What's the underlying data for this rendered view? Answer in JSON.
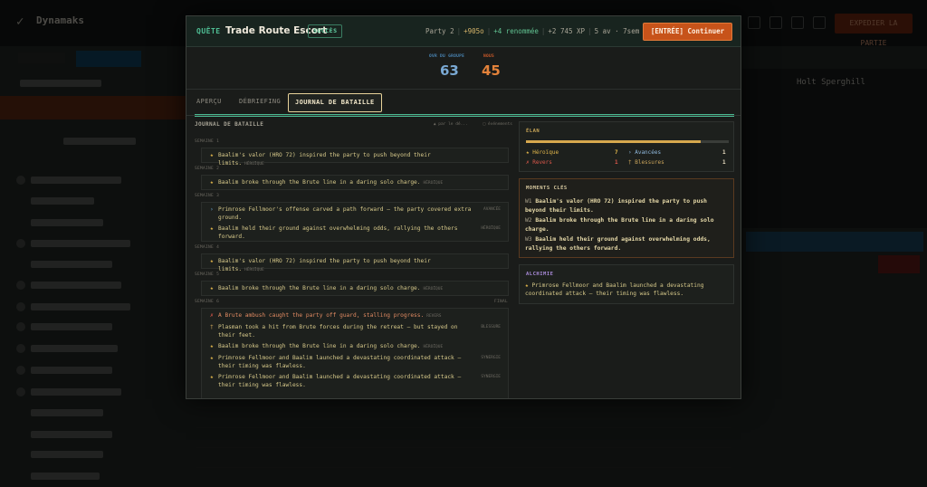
{
  "background": {
    "brand": "Dynamaks",
    "alert_label": "EXPEDIER LA PARTIE",
    "profile_name": "Holt Sperghill"
  },
  "quest": {
    "label": "QUÊTE",
    "title": "Trade Route Escort",
    "status": "SUCCÈS",
    "party": "Party 2",
    "gold": "+905o",
    "renown": "+4 renommée",
    "xp": "+2 745 XP",
    "time": "5 av · 7sem",
    "continue_label": "[ENTRÉE] Continuer"
  },
  "scores": {
    "group_label": "OVR DU GROUPE",
    "group_value": "63",
    "enemy_label": "NOUS",
    "enemy_value": "45",
    "progress_fraction": 1.0
  },
  "tabs": [
    {
      "label": "APERÇU"
    },
    {
      "label": "DÉBRIEFING"
    },
    {
      "label": "JOURNAL DE BATAILLE"
    }
  ],
  "journal": {
    "title": "JOURNAL DE BATAILLE",
    "tool_1": "▲ par le dé...",
    "tool_2": "□ événements",
    "turns": [
      {
        "label": "SEMAINE 1",
        "events": [
          {
            "icon": "★",
            "text": "Baalim's valor (HRO 72) inspired the party to push beyond their limits.",
            "tag": "HÉROÏQUE"
          }
        ]
      },
      {
        "label": "SEMAINE 2",
        "events": [
          {
            "icon": "★",
            "text": "Baalim broke through the Brute line in a daring solo charge.",
            "tag": "HÉROÏQUE"
          }
        ]
      },
      {
        "label": "SEMAINE 3",
        "events": [
          {
            "icon": "›",
            "text": "Primrose Fellmoor's offense carved a path forward — the party covered extra ground.",
            "rtag": "AVANCÉE"
          },
          {
            "icon": "★",
            "text": "Baalim held their ground against overwhelming odds, rallying the others forward.",
            "rtag": "HÉROÏQUE"
          }
        ]
      },
      {
        "label": "SEMAINE 4",
        "events": [
          {
            "icon": "★",
            "text": "Baalim's valor (HRO 72) inspired the party to push beyond their limits.",
            "tag": "HÉROÏQUE"
          }
        ]
      },
      {
        "label": "SEMAINE 5",
        "events": [
          {
            "icon": "★",
            "text": "Baalim broke through the Brute line in a daring solo charge.",
            "tag": "HÉROÏQUE"
          }
        ]
      },
      {
        "label": "SEMAINE 6",
        "right": "FINAL",
        "events": [
          {
            "icon": "✗",
            "text": "A Brute ambush caught the party off guard, stalling progress.",
            "tag": "REVERS"
          },
          {
            "icon": "†",
            "text": "Plasman took a hit from Brute forces during the retreat — but stayed on their feet.",
            "rtag": "BLESSURE"
          },
          {
            "icon": "★",
            "text": "Baalim broke through the Brute line in a daring solo charge.",
            "tag": "HÉROÏQUE"
          },
          {
            "icon": "★",
            "text": "Primrose Fellmoor and Baalim launched a devastating coordinated attack — their timing was flawless.",
            "rtag": "SYNERGIE"
          },
          {
            "icon": "★",
            "text": "Primrose Fellmoor and Baalim launched a devastating coordinated attack — their timing was flawless.",
            "rtag": "SYNERGIE"
          }
        ]
      }
    ]
  },
  "elan": {
    "title": "ÉLAN",
    "fill_fraction": 0.86,
    "heroic_label": "★ Héroïque",
    "heroic_value": "7",
    "advances_label": "› Avancées",
    "advances_value": "1",
    "setbacks_label": "✗ Revers",
    "setbacks_value": "1",
    "injuries_label": "† Blessures",
    "injuries_value": "1"
  },
  "moments": {
    "title": "MOMENTS CLÉS",
    "items": [
      {
        "week": "W1",
        "text": "Baalim's valor (HRO 72) inspired the party to push beyond their limits."
      },
      {
        "week": "W2",
        "text": "Baalim broke through the Brute line in a daring solo charge."
      },
      {
        "week": "W3",
        "text": "Baalim held their ground against overwhelming odds, rallying the others forward."
      }
    ]
  },
  "alchimie": {
    "title": "ALCHIMIE",
    "text": "Primrose Fellmoor and Baalim launched a devastating coordinated attack — their timing was flawless."
  },
  "colors": {
    "accent_green": "#4ab991",
    "accent_orange": "#c7531a",
    "gold": "#d6a84d",
    "blue": "#7aa9d4"
  }
}
